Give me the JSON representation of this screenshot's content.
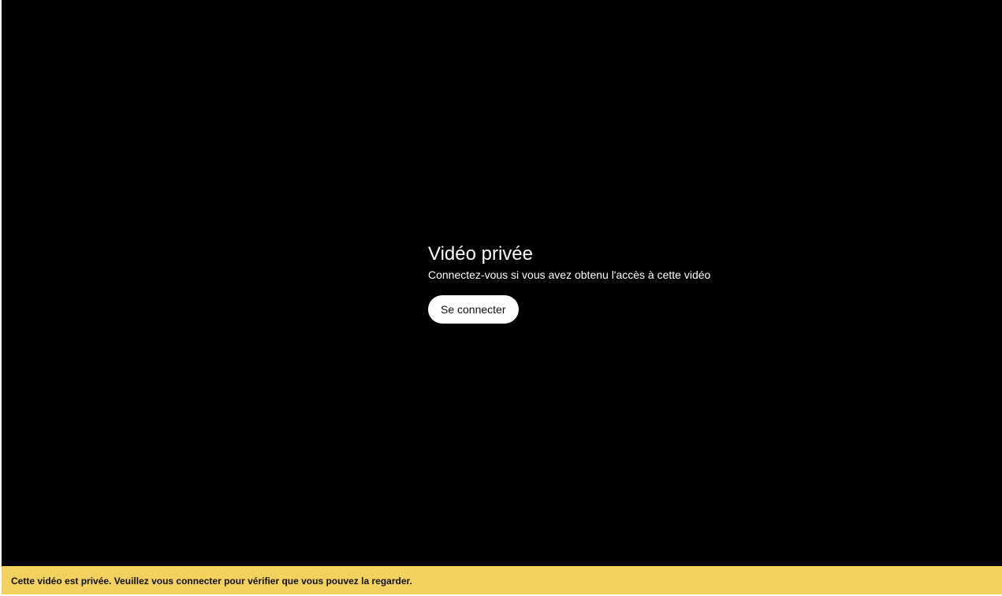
{
  "player": {
    "title": "Vidéo privée",
    "subtitle": "Connectez-vous si vous avez obtenu l'accès à cette vidéo",
    "signin_label": "Se connecter"
  },
  "notice": {
    "text": "Cette vidéo est privée. Veuillez vous connecter pour vérifier que vous pouvez la regarder."
  },
  "colors": {
    "player_background": "#000000",
    "notice_background": "#f2d15e",
    "button_background": "#ffffff"
  }
}
